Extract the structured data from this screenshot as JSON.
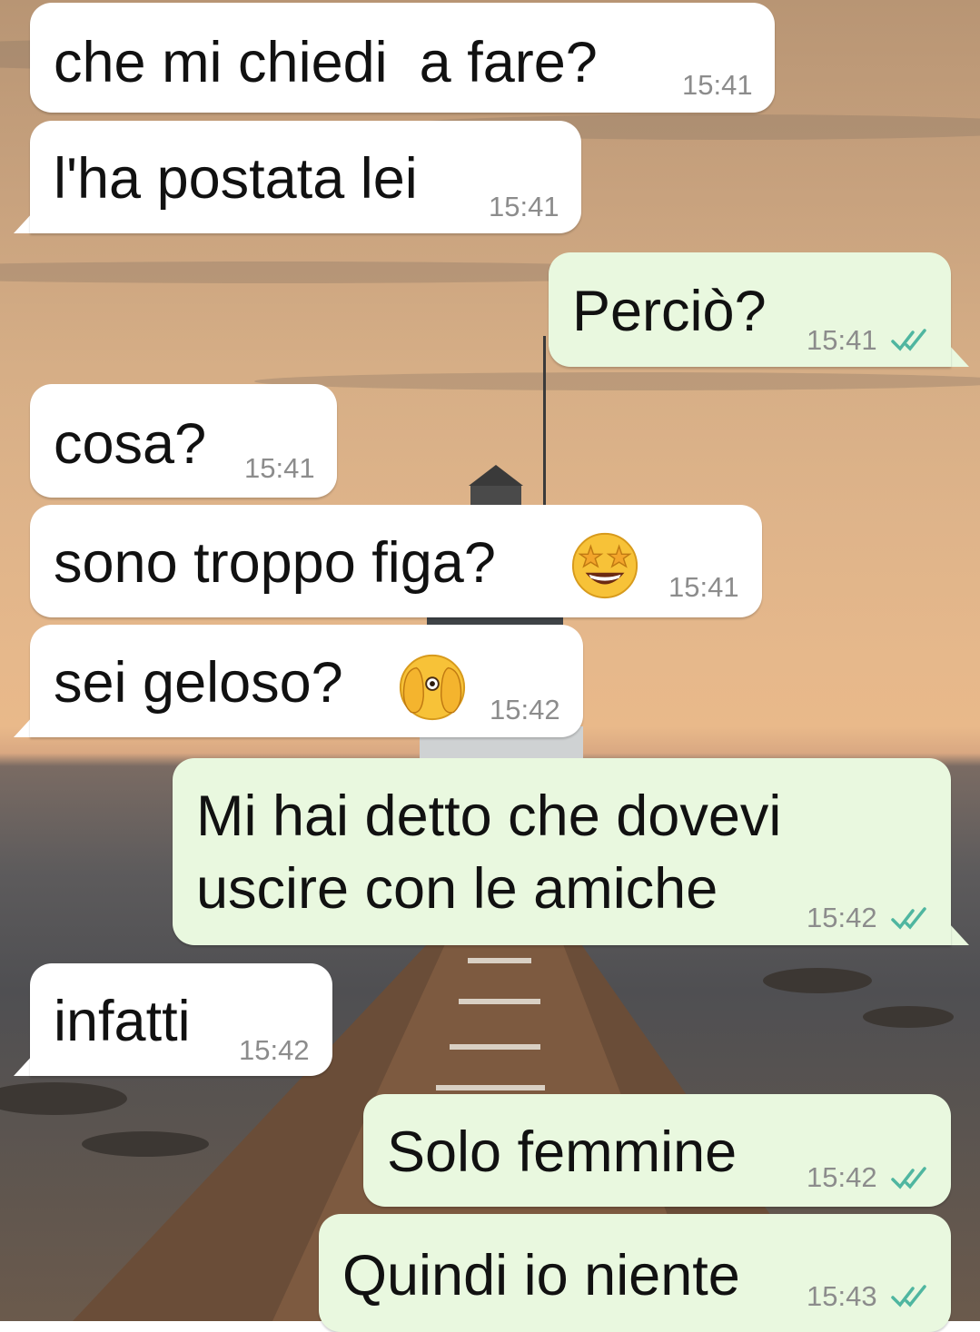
{
  "conversation": {
    "messages": [
      {
        "side": "in",
        "text": "che mi chiedi  a fare?",
        "time": "15:41"
      },
      {
        "side": "in",
        "text": "l'ha postata lei",
        "time": "15:41"
      },
      {
        "side": "out",
        "text": "Perciò?",
        "time": "15:41",
        "status": "read"
      },
      {
        "side": "in",
        "text": "cosa?",
        "time": "15:41"
      },
      {
        "side": "in",
        "text": "sono troppo figa?",
        "time": "15:41",
        "emoji": "star-struck-emoji-icon"
      },
      {
        "side": "in",
        "text": "sei geloso?",
        "time": "15:42",
        "emoji": "face-with-hands-over-eyes-emoji-icon"
      },
      {
        "side": "out",
        "text": "Mi hai detto che dovevi uscire con le amiche",
        "time": "15:42",
        "status": "read"
      },
      {
        "side": "in",
        "text": "infatti",
        "time": "15:42"
      },
      {
        "side": "out",
        "text": "Solo femmine",
        "time": "15:42",
        "status": "read"
      },
      {
        "side": "out",
        "text": "Quindi io niente",
        "time": "15:43",
        "status": "read"
      }
    ]
  },
  "colors": {
    "incoming_bubble": "#ffffff",
    "outgoing_bubble": "#e9f8df",
    "read_ticks": "#4fb6a0",
    "timestamp": "#8c8c8c"
  }
}
